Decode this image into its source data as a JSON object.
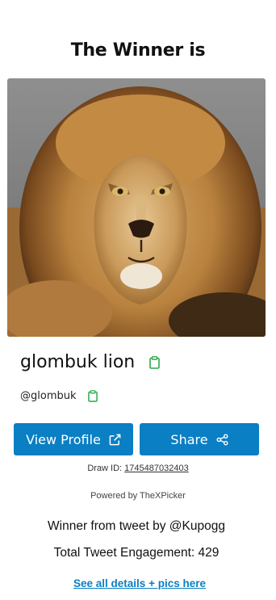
{
  "header": {
    "title": "The Winner is"
  },
  "winner": {
    "photo_alt": "lion-photo",
    "name": "glombuk lion",
    "handle": "@glombuk"
  },
  "actions": {
    "view_profile_label": "View Profile",
    "share_label": "Share"
  },
  "draw": {
    "label": "Draw ID:",
    "id": "1745487032403"
  },
  "powered_by": "Powered by TheXPicker",
  "tweet_info": {
    "winner_from": "Winner from tweet by @Kupogg",
    "engagement": "Total Tweet Engagement: 429"
  },
  "details_link": "See all details + pics here",
  "colors": {
    "accent": "#0a7fc4",
    "copy_icon": "#2aa84a"
  }
}
